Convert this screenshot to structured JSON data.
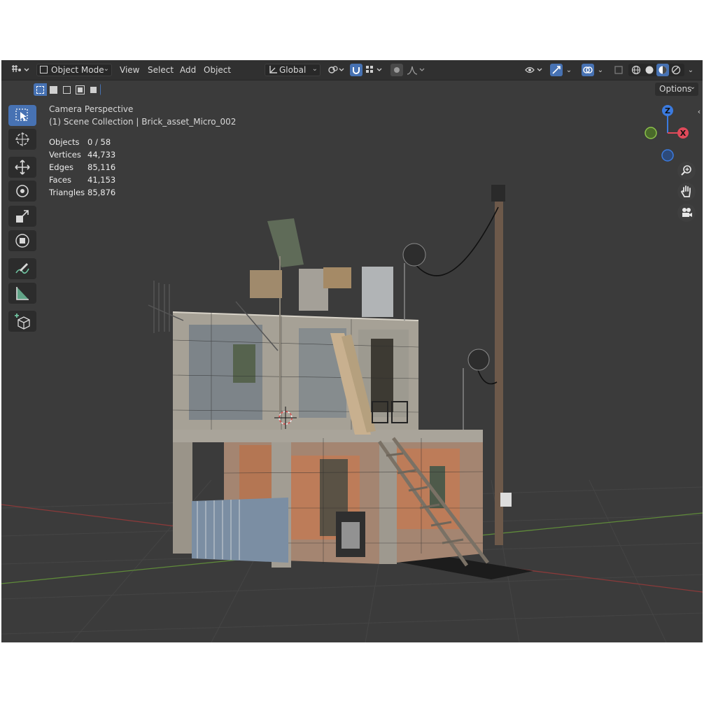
{
  "header": {
    "editor_icon": "editor-type-icon",
    "mode": "Object Mode",
    "menus": [
      "View",
      "Select",
      "Add",
      "Object"
    ],
    "orientation": "Global",
    "options": "Options"
  },
  "overlay": {
    "view_name": "Camera Perspective",
    "collection": "(1) Scene Collection | Brick_asset_Micro_002",
    "stats": [
      {
        "label": "Objects",
        "value": "0 / 58"
      },
      {
        "label": "Vertices",
        "value": "44,733"
      },
      {
        "label": "Edges",
        "value": "85,116"
      },
      {
        "label": "Faces",
        "value": "41,153"
      },
      {
        "label": "Triangles",
        "value": "85,876"
      }
    ]
  },
  "gizmo": {
    "z": "Z",
    "x": "X"
  },
  "colors": {
    "accent": "#4772b3",
    "x_axis": "#e04a5a",
    "y_axis": "#8bc14a",
    "z_axis": "#3b7be0"
  },
  "tools": [
    "select-box-icon",
    "cursor-icon",
    "move-icon",
    "rotate-icon",
    "scale-icon",
    "transform-icon",
    "annotate-icon",
    "measure-icon",
    "add-cube-icon"
  ]
}
